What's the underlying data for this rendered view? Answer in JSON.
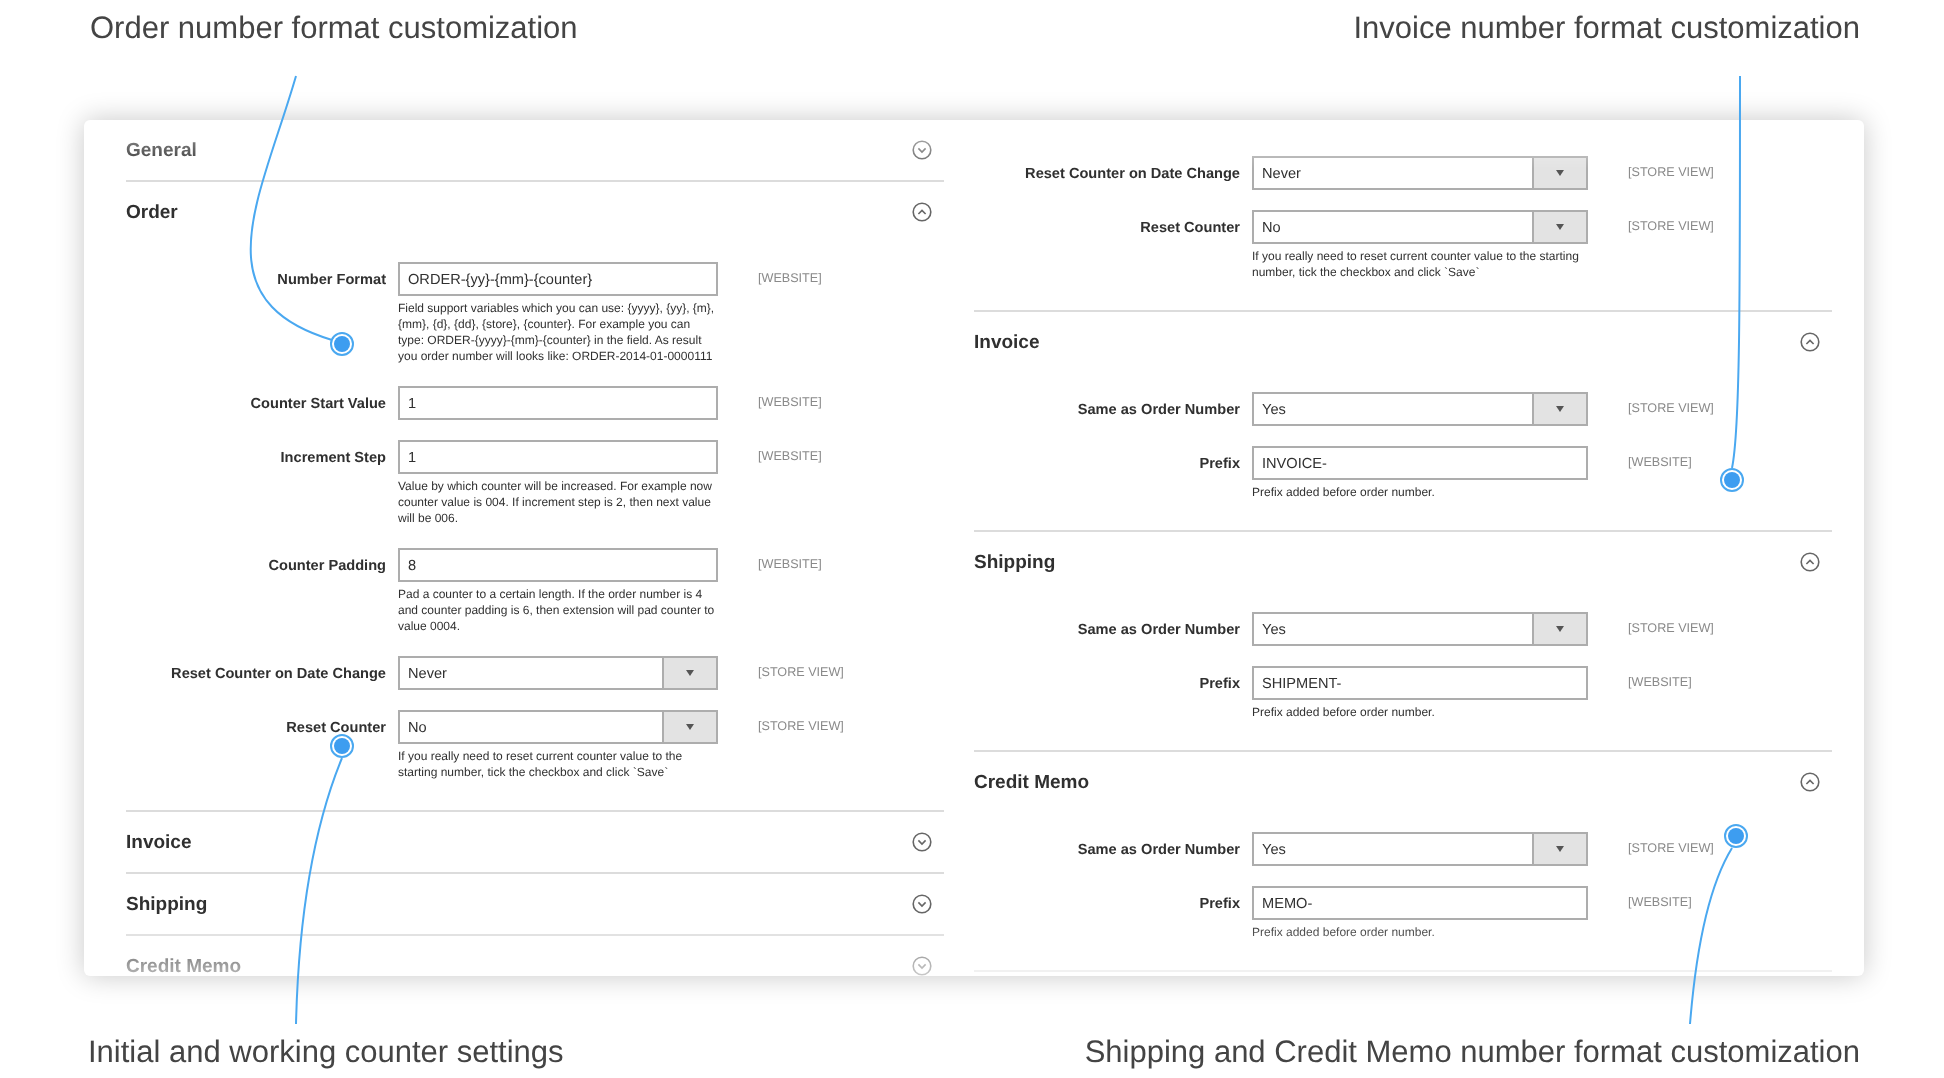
{
  "callouts": [
    {
      "text": "Order number format customization"
    },
    {
      "text": "Invoice number format customization"
    },
    {
      "text": "Initial and working counter settings"
    },
    {
      "text": "Shipping and Credit Memo number format customization"
    }
  ],
  "columns": [
    {
      "sections": [
        {
          "title": "General",
          "expanded": false
        },
        {
          "title": "Order",
          "expanded": true,
          "fields": [
            {
              "kind": "text",
              "label": "Number Format",
              "value": "ORDER-{yy}-{mm}-{counter}",
              "scope": "[WEBSITE]",
              "note": "Field support variables which you can use: {yyyy}, {yy}, {m}, {mm}, {d}, {dd}, {store}, {counter}. For example you can type: ORDER-{yyyy}-{mm}-{counter} in the field. As result you order number will looks like: ORDER-2014-01-0000111"
            },
            {
              "kind": "text",
              "label": "Counter Start Value",
              "value": "1",
              "scope": "[WEBSITE]"
            },
            {
              "kind": "text",
              "label": "Increment Step",
              "value": "1",
              "scope": "[WEBSITE]",
              "note": "Value by which counter will be increased. For example now counter value is 004. If increment step is 2, then next value will be 006."
            },
            {
              "kind": "text",
              "label": "Counter Padding",
              "value": "8",
              "scope": "[WEBSITE]",
              "note": "Pad a counter to a certain length. If the order number is 4 and counter padding is 6, then extension will pad counter to value 0004."
            },
            {
              "kind": "select",
              "label": "Reset Counter on Date Change",
              "value": "Never",
              "scope": "[STORE VIEW]"
            },
            {
              "kind": "select",
              "label": "Reset Counter",
              "value": "No",
              "scope": "[STORE VIEW]",
              "note": "If you really need to reset current counter value to the starting number, tick the checkbox and click `Save`"
            }
          ]
        },
        {
          "title": "Invoice",
          "expanded": false
        },
        {
          "title": "Shipping",
          "expanded": false
        },
        {
          "title": "Credit Memo",
          "expanded": false
        }
      ]
    },
    {
      "sections": [
        {
          "fields": [
            {
              "kind": "select",
              "label": "Reset Counter on Date Change",
              "value": "Never",
              "scope": "[STORE VIEW]"
            },
            {
              "kind": "select",
              "label": "Reset Counter",
              "value": "No",
              "scope": "[STORE VIEW]",
              "note": "If you really need to reset current counter value to the starting number, tick the checkbox and click `Save`"
            }
          ]
        },
        {
          "title": "Invoice",
          "expanded": true,
          "fields": [
            {
              "kind": "select",
              "label": "Same as Order Number",
              "value": "Yes",
              "scope": "[STORE VIEW]"
            },
            {
              "kind": "text",
              "label": "Prefix",
              "value": "INVOICE-",
              "scope": "[WEBSITE]",
              "note": "Prefix added before order number."
            }
          ]
        },
        {
          "title": "Shipping",
          "expanded": true,
          "fields": [
            {
              "kind": "select",
              "label": "Same as Order Number",
              "value": "Yes",
              "scope": "[STORE VIEW]"
            },
            {
              "kind": "text",
              "label": "Prefix",
              "value": "SHIPMENT-",
              "scope": "[WEBSITE]",
              "note": "Prefix added before order number."
            }
          ]
        },
        {
          "title": "Credit Memo",
          "expanded": true,
          "fields": [
            {
              "kind": "select",
              "label": "Same as Order Number",
              "value": "Yes",
              "scope": "[STORE VIEW]"
            },
            {
              "kind": "text",
              "label": "Prefix",
              "value": "MEMO-",
              "scope": "[WEBSITE]",
              "note": "Prefix added before order number."
            }
          ]
        }
      ]
    }
  ]
}
